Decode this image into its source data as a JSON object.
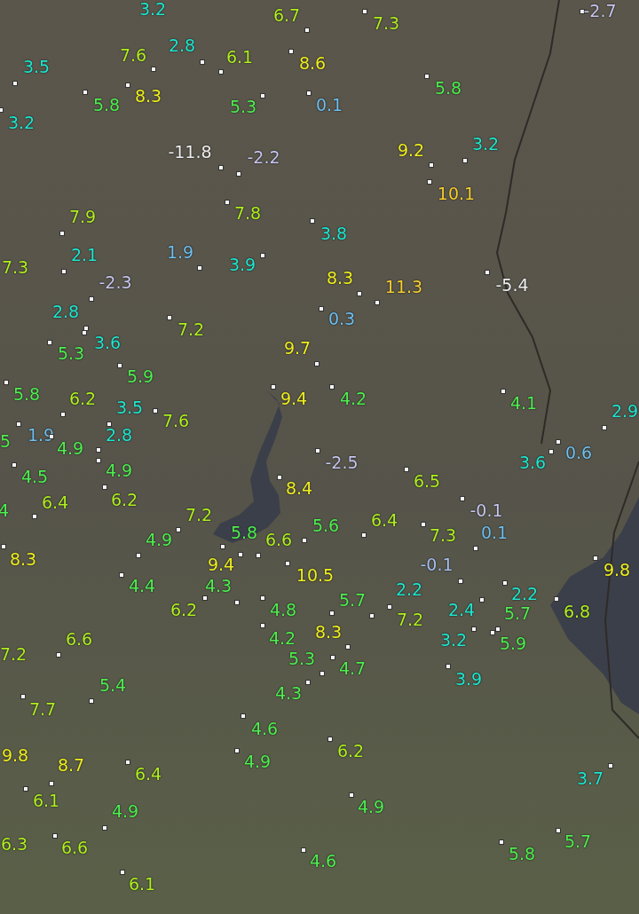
{
  "map": {
    "stations": [
      {
        "value": "3.2",
        "color": "#20e8d0"
      },
      {
        "value": "6.7",
        "color": "#b0f020"
      },
      {
        "value": "7.3",
        "color": "#b0f020"
      },
      {
        "value": "-2.7",
        "color": "#c8c8f0"
      },
      {
        "value": "3.5",
        "color": "#20e8d0"
      },
      {
        "value": "7.6",
        "color": "#b0f020"
      },
      {
        "value": "2.8",
        "color": "#20e8d0"
      },
      {
        "value": "6.1",
        "color": "#b0f020"
      },
      {
        "value": "8.6",
        "color": "#f0f020"
      },
      {
        "value": "5.8",
        "color": "#50f050"
      },
      {
        "value": "5.8",
        "color": "#50f050"
      },
      {
        "value": "8.3",
        "color": "#f0f020"
      },
      {
        "value": "5.3",
        "color": "#50f050"
      },
      {
        "value": "0.1",
        "color": "#70c0f0"
      },
      {
        "value": "3.2",
        "color": "#20e8d0"
      },
      {
        "value": "-11.8",
        "color": "#f0f0f0"
      },
      {
        "value": "-2.2",
        "color": "#c8c8f0"
      },
      {
        "value": "9.2",
        "color": "#f0f020"
      },
      {
        "value": "3.2",
        "color": "#20e8d0"
      },
      {
        "value": "10.1",
        "color": "#f8d030"
      },
      {
        "value": "7.9",
        "color": "#b0f020"
      },
      {
        "value": "7.8",
        "color": "#b0f020"
      },
      {
        "value": "3.8",
        "color": "#20e8d0"
      },
      {
        "value": "7.3",
        "color": "#b0f020"
      },
      {
        "value": "2.1",
        "color": "#20e8d0"
      },
      {
        "value": "1.9",
        "color": "#70c0f0"
      },
      {
        "value": "3.9",
        "color": "#20e8d0"
      },
      {
        "value": "-2.3",
        "color": "#c8c8f0"
      },
      {
        "value": "8.3",
        "color": "#f0f020"
      },
      {
        "value": "11.3",
        "color": "#f8d030"
      },
      {
        "value": "-5.4",
        "color": "#f0f0f0"
      },
      {
        "value": "2.8",
        "color": "#20e8d0"
      },
      {
        "value": "0.3",
        "color": "#70c0f0"
      },
      {
        "value": "7.2",
        "color": "#b0f020"
      },
      {
        "value": "3.6",
        "color": "#20e8d0"
      },
      {
        "value": "5.3",
        "color": "#50f050"
      },
      {
        "value": "9.7",
        "color": "#f0f020"
      },
      {
        "value": "5.9",
        "color": "#50f050"
      },
      {
        "value": "5.8",
        "color": "#50f050"
      },
      {
        "value": "6.2",
        "color": "#b0f020"
      },
      {
        "value": "9.4",
        "color": "#f0f020"
      },
      {
        "value": "4.2",
        "color": "#50f050"
      },
      {
        "value": "3.5",
        "color": "#20e8d0"
      },
      {
        "value": "4.1",
        "color": "#50f050"
      },
      {
        "value": "7.6",
        "color": "#b0f020"
      },
      {
        "value": "2.9",
        "color": "#20e8d0"
      },
      {
        "value": "5",
        "color": "#50f050"
      },
      {
        "value": "1.9",
        "color": "#70c0f0"
      },
      {
        "value": "4.9",
        "color": "#50f050"
      },
      {
        "value": "2.8",
        "color": "#20e8d0"
      },
      {
        "value": "-2.5",
        "color": "#c8c8f0"
      },
      {
        "value": "3.6",
        "color": "#20e8d0"
      },
      {
        "value": "0.6",
        "color": "#70c0f0"
      },
      {
        "value": "4.5",
        "color": "#50f050"
      },
      {
        "value": "4.9",
        "color": "#50f050"
      },
      {
        "value": "8.4",
        "color": "#f0f020"
      },
      {
        "value": "6.5",
        "color": "#b0f020"
      },
      {
        "value": "4",
        "color": "#50f050"
      },
      {
        "value": "6.4",
        "color": "#b0f020"
      },
      {
        "value": "6.2",
        "color": "#b0f020"
      },
      {
        "value": "7.2",
        "color": "#b0f020"
      },
      {
        "value": "-0.1",
        "color": "#c8c8f0"
      },
      {
        "value": "6.4",
        "color": "#b0f020"
      },
      {
        "value": "4.9",
        "color": "#50f050"
      },
      {
        "value": "5.8",
        "color": "#50f050"
      },
      {
        "value": "5.6",
        "color": "#50f050"
      },
      {
        "value": "6.6",
        "color": "#b0f020"
      },
      {
        "value": "7.3",
        "color": "#b0f020"
      },
      {
        "value": "0.1",
        "color": "#70c0f0"
      },
      {
        "value": "8.3",
        "color": "#f0f020"
      },
      {
        "value": "9.4",
        "color": "#f0f020"
      },
      {
        "value": "-0.1",
        "color": "#a8c0f0"
      },
      {
        "value": "10.5",
        "color": "#f0f020"
      },
      {
        "value": "9.8",
        "color": "#f0f020"
      },
      {
        "value": "4.4",
        "color": "#50f050"
      },
      {
        "value": "4.3",
        "color": "#50f050"
      },
      {
        "value": "5.7",
        "color": "#50f050"
      },
      {
        "value": "2.2",
        "color": "#20e8d0"
      },
      {
        "value": "2.2",
        "color": "#20e8d0"
      },
      {
        "value": "6.2",
        "color": "#b0f020"
      },
      {
        "value": "4.8",
        "color": "#50f050"
      },
      {
        "value": "7.2",
        "color": "#b0f020"
      },
      {
        "value": "2.4",
        "color": "#20e8d0"
      },
      {
        "value": "5.7",
        "color": "#50f050"
      },
      {
        "value": "6.8",
        "color": "#b0f020"
      },
      {
        "value": "6.6",
        "color": "#b0f020"
      },
      {
        "value": "4.2",
        "color": "#50f050"
      },
      {
        "value": "8.3",
        "color": "#f0f020"
      },
      {
        "value": "3.2",
        "color": "#20e8d0"
      },
      {
        "value": "5.9",
        "color": "#50f050"
      },
      {
        "value": "7.2",
        "color": "#b0f020"
      },
      {
        "value": "5.3",
        "color": "#50f050"
      },
      {
        "value": "4.7",
        "color": "#50f050"
      },
      {
        "value": "5.4",
        "color": "#50f050"
      },
      {
        "value": "3.9",
        "color": "#20e8d0"
      },
      {
        "value": "4.3",
        "color": "#50f050"
      },
      {
        "value": "7.7",
        "color": "#b0f020"
      },
      {
        "value": "4.6",
        "color": "#50f050"
      },
      {
        "value": "9.8",
        "color": "#f0f020"
      },
      {
        "value": "6.2",
        "color": "#b0f020"
      },
      {
        "value": "8.7",
        "color": "#f0f020"
      },
      {
        "value": "4.9",
        "color": "#50f050"
      },
      {
        "value": "6.4",
        "color": "#b0f020"
      },
      {
        "value": "3.7",
        "color": "#20e8d0"
      },
      {
        "value": "6.1",
        "color": "#b0f020"
      },
      {
        "value": "4.9",
        "color": "#50f050"
      },
      {
        "value": "4.9",
        "color": "#50f050"
      },
      {
        "value": "6.3",
        "color": "#b0f020"
      },
      {
        "value": "6.6",
        "color": "#b0f020"
      },
      {
        "value": "5.7",
        "color": "#50f050"
      },
      {
        "value": "4.6",
        "color": "#50f050"
      },
      {
        "value": "5.8",
        "color": "#50f050"
      },
      {
        "value": "6.1",
        "color": "#b0f020"
      }
    ]
  }
}
